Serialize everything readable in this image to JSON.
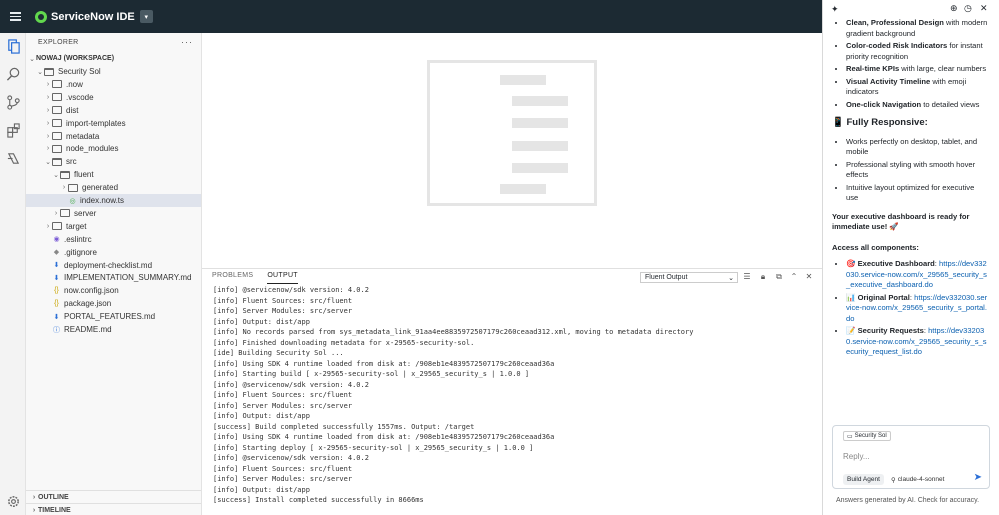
{
  "app": {
    "title": "ServiceNow IDE"
  },
  "explorer": {
    "header": "EXPLORER",
    "workspace": "NOWAJ (WORKSPACE)",
    "items": [
      {
        "label": "Security Sol",
        "depth": 0,
        "kind": "folder-open",
        "chevron": "down"
      },
      {
        "label": ".now",
        "depth": 1,
        "kind": "folder",
        "chevron": "right"
      },
      {
        "label": ".vscode",
        "depth": 1,
        "kind": "folder",
        "chevron": "right"
      },
      {
        "label": "dist",
        "depth": 1,
        "kind": "folder",
        "chevron": "right"
      },
      {
        "label": "import-templates",
        "depth": 1,
        "kind": "folder",
        "chevron": "right"
      },
      {
        "label": "metadata",
        "depth": 1,
        "kind": "folder",
        "chevron": "right"
      },
      {
        "label": "node_modules",
        "depth": 1,
        "kind": "folder",
        "chevron": "right"
      },
      {
        "label": "src",
        "depth": 1,
        "kind": "folder-open",
        "chevron": "down"
      },
      {
        "label": "fluent",
        "depth": 2,
        "kind": "folder-open",
        "chevron": "down"
      },
      {
        "label": "generated",
        "depth": 3,
        "kind": "folder",
        "chevron": "right"
      },
      {
        "label": "index.now.ts",
        "depth": 3,
        "kind": "file-now",
        "selected": true
      },
      {
        "label": "server",
        "depth": 2,
        "kind": "folder",
        "chevron": "right"
      },
      {
        "label": "target",
        "depth": 1,
        "kind": "folder",
        "chevron": "right"
      },
      {
        "label": ".eslintrc",
        "depth": 1,
        "kind": "file-eslint"
      },
      {
        "label": ".gitignore",
        "depth": 1,
        "kind": "file-git"
      },
      {
        "label": "deployment-checklist.md",
        "depth": 1,
        "kind": "file-md"
      },
      {
        "label": "IMPLEMENTATION_SUMMARY.md",
        "depth": 1,
        "kind": "file-md"
      },
      {
        "label": "now.config.json",
        "depth": 1,
        "kind": "file-json"
      },
      {
        "label": "package.json",
        "depth": 1,
        "kind": "file-json"
      },
      {
        "label": "PORTAL_FEATURES.md",
        "depth": 1,
        "kind": "file-md"
      },
      {
        "label": "README.md",
        "depth": 1,
        "kind": "file-info"
      }
    ],
    "outline": "OUTLINE",
    "timeline": "TIMELINE"
  },
  "panel": {
    "tabs": [
      "PROBLEMS",
      "OUTPUT"
    ],
    "active_tab": "OUTPUT",
    "output_channel": "Fluent Output",
    "log": [
      "[info] @servicenow/sdk version: 4.0.2",
      "[info] Fluent Sources: src/fluent",
      "[info] Server Modules: src/server",
      "[info] Output: dist/app",
      "[info] No records parsed from sys_metadata_link_91aa4ee8835972507179c260ceaad312.xml, moving to metadata directory",
      "[info] Finished downloading metadata for x-29565-security-sol.",
      "[ide] Building Security Sol ...",
      "[info] Using SDK 4 runtime loaded from disk at: /908eb1e4839572507179c260ceaad36a",
      "[info] Starting build [ x-29565-security-sol | x_29565_security_s | 1.0.0 ]",
      "[info] @servicenow/sdk version: 4.0.2",
      "[info] Fluent Sources: src/fluent",
      "[info] Server Modules: src/server",
      "[info] Output: dist/app",
      "[success] Build completed successfully 1557ms. Output: /target",
      "[info] Using SDK 4 runtime loaded from disk at: /908eb1e4839572507179c260ceaad36a",
      "[info] Starting deploy [ x-29565-security-sol | x_29565_security_s | 1.0.0 ]",
      "[info] @servicenow/sdk version: 4.0.2",
      "[info] Fluent Sources: src/fluent",
      "[info] Server Modules: src/server",
      "[info] Output: dist/app",
      "[success] Install completed successfully in 8666ms"
    ]
  },
  "chat": {
    "design_items": [
      {
        "bold": "Clean, Professional Design",
        "rest": " with modern gradient background"
      },
      {
        "bold": "Color-coded Risk Indicators",
        "rest": " for instant priority recognition"
      },
      {
        "bold": "Real-time KPIs",
        "rest": " with large, clear numbers"
      },
      {
        "bold": "Visual Activity Timeline",
        "rest": " with emoji indicators"
      },
      {
        "bold": "One-click Navigation",
        "rest": " to detailed views"
      }
    ],
    "responsive_heading": "📱 Fully Responsive:",
    "responsive_items": [
      "Works perfectly on desktop, tablet, and mobile",
      "Professional styling with smooth hover effects",
      "Intuitive layout optimized for executive use"
    ],
    "ready_text": "Your executive dashboard is ready for immediate use! 🚀",
    "access_text": "Access all components:",
    "components": [
      {
        "label": "🎯 Executive Dashboard",
        "url": "https://dev332030.service-now.com/x_29565_security_s_executive_dashboard.do"
      },
      {
        "label": "📊 Original Portal",
        "url": "https://dev332030.service-now.com/x_29565_security_s_portal.do"
      },
      {
        "label": "📝 Security Requests",
        "url": "https://dev332030.service-now.com/x_29565_security_s_security_request_list.do"
      }
    ],
    "context_chip": "Security Sol",
    "reply_placeholder": "Reply...",
    "agent_button": "Build Agent",
    "model": "claude-4-sonnet",
    "disclaimer": "Answers generated by AI. Check for accuracy."
  }
}
